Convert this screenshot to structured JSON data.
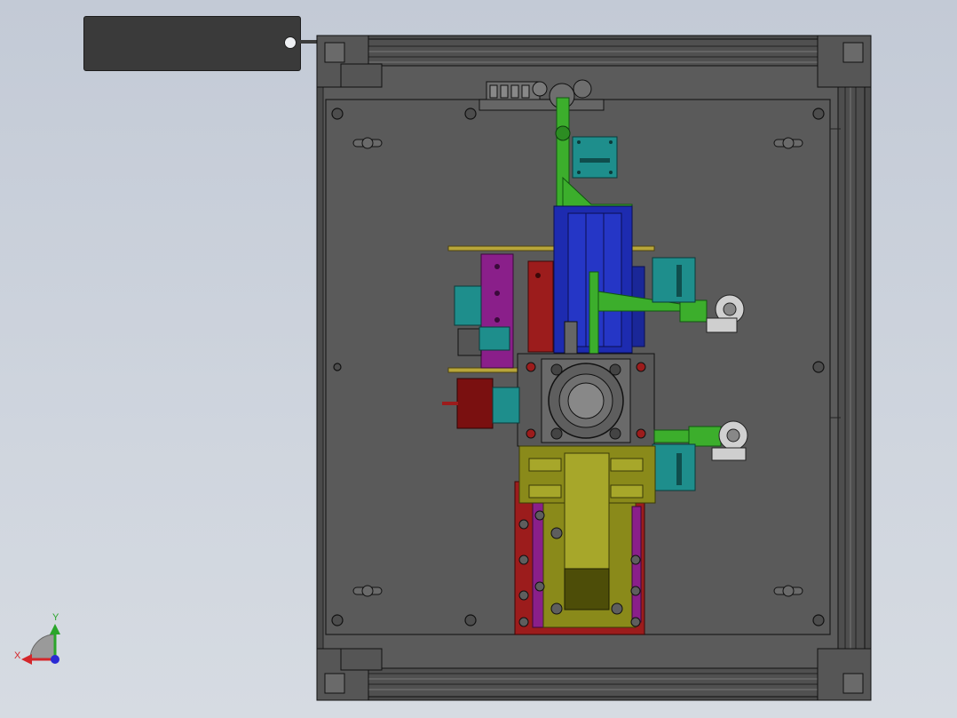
{
  "viewport": {
    "background": "#c9cfd9",
    "colors": {
      "frame": "#4a4a4a",
      "plate": "#5a5a5a",
      "blue": "#1d2bb0",
      "green": "#3cae2c",
      "teal": "#1e8e8c",
      "purple": "#8a1f8a",
      "red": "#9c1c1c",
      "olive": "#8a8a1a",
      "darkred": "#7a1010"
    }
  },
  "triad": {
    "x_label": "X",
    "y_label": "Y",
    "x_color": "#d4262a",
    "y_color": "#2aa52a",
    "z_color": "#2a2ad4"
  },
  "tag": {
    "icon": "note-tag"
  }
}
